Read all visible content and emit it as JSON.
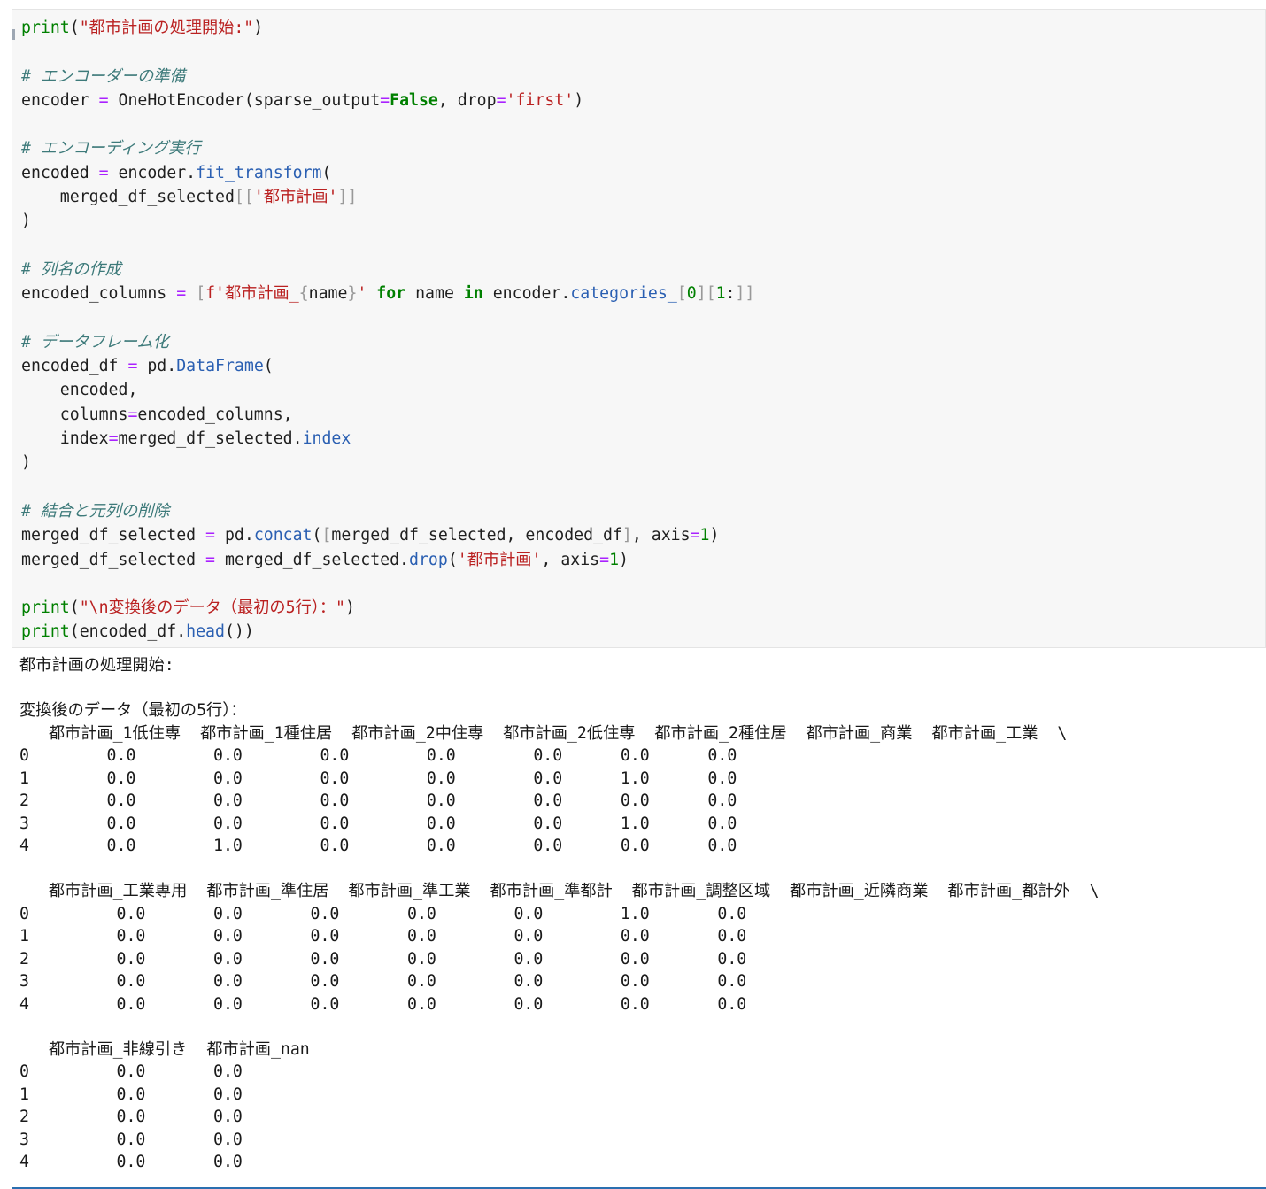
{
  "code_cell": {
    "lines": [
      [
        {
          "t": "print",
          "c": "kw"
        },
        {
          "t": "("
        },
        {
          "t": "\"都市計画の処理開始:\"",
          "c": "st"
        },
        {
          "t": ")"
        }
      ],
      [],
      [
        {
          "t": "# エンコーダーの準備",
          "c": "cm"
        }
      ],
      [
        {
          "t": "encoder "
        },
        {
          "t": "=",
          "c": "op"
        },
        {
          "t": " OneHotEncoder(sparse_output"
        },
        {
          "t": "=",
          "c": "op"
        },
        {
          "t": "False",
          "c": "kwb"
        },
        {
          "t": ", drop"
        },
        {
          "t": "=",
          "c": "op"
        },
        {
          "t": "'first'",
          "c": "st"
        },
        {
          "t": ")"
        }
      ],
      [],
      [
        {
          "t": "# エンコーディング実行",
          "c": "cm"
        }
      ],
      [
        {
          "t": "encoded "
        },
        {
          "t": "=",
          "c": "op"
        },
        {
          "t": " encoder."
        },
        {
          "t": "fit_transform",
          "c": "at"
        },
        {
          "t": "("
        }
      ],
      [
        {
          "t": "    merged_df_selected"
        },
        {
          "t": "[[",
          "c": "br"
        },
        {
          "t": "'都市計画'",
          "c": "st"
        },
        {
          "t": "]]",
          "c": "br"
        }
      ],
      [
        {
          "t": ")"
        }
      ],
      [],
      [
        {
          "t": "# 列名の作成",
          "c": "cm"
        }
      ],
      [
        {
          "t": "encoded_columns "
        },
        {
          "t": "=",
          "c": "op"
        },
        {
          "t": " "
        },
        {
          "t": "[",
          "c": "br"
        },
        {
          "t": "f'都市計画_",
          "c": "st"
        },
        {
          "t": "{",
          "c": "br"
        },
        {
          "t": "name"
        },
        {
          "t": "}",
          "c": "br"
        },
        {
          "t": "'",
          "c": "st"
        },
        {
          "t": " "
        },
        {
          "t": "for",
          "c": "kwb"
        },
        {
          "t": " name "
        },
        {
          "t": "in",
          "c": "kwb"
        },
        {
          "t": " encoder."
        },
        {
          "t": "categories_",
          "c": "at"
        },
        {
          "t": "[",
          "c": "br"
        },
        {
          "t": "0",
          "c": "nm"
        },
        {
          "t": "][",
          "c": "br"
        },
        {
          "t": "1",
          "c": "nm"
        },
        {
          "t": ":"
        },
        {
          "t": "]]",
          "c": "br"
        }
      ],
      [],
      [
        {
          "t": "# データフレーム化",
          "c": "cm"
        }
      ],
      [
        {
          "t": "encoded_df "
        },
        {
          "t": "=",
          "c": "op"
        },
        {
          "t": " pd."
        },
        {
          "t": "DataFrame",
          "c": "at"
        },
        {
          "t": "("
        }
      ],
      [
        {
          "t": "    encoded,"
        }
      ],
      [
        {
          "t": "    columns"
        },
        {
          "t": "=",
          "c": "op"
        },
        {
          "t": "encoded_columns,"
        }
      ],
      [
        {
          "t": "    index"
        },
        {
          "t": "=",
          "c": "op"
        },
        {
          "t": "merged_df_selected."
        },
        {
          "t": "index",
          "c": "at"
        }
      ],
      [
        {
          "t": ")"
        }
      ],
      [],
      [
        {
          "t": "# 結合と元列の削除",
          "c": "cm"
        }
      ],
      [
        {
          "t": "merged_df_selected "
        },
        {
          "t": "=",
          "c": "op"
        },
        {
          "t": " pd."
        },
        {
          "t": "concat",
          "c": "at"
        },
        {
          "t": "("
        },
        {
          "t": "[",
          "c": "br"
        },
        {
          "t": "merged_df_selected, encoded_df"
        },
        {
          "t": "]",
          "c": "br"
        },
        {
          "t": ", axis"
        },
        {
          "t": "=",
          "c": "op"
        },
        {
          "t": "1",
          "c": "nm"
        },
        {
          "t": ")"
        }
      ],
      [
        {
          "t": "merged_df_selected "
        },
        {
          "t": "=",
          "c": "op"
        },
        {
          "t": " merged_df_selected."
        },
        {
          "t": "drop",
          "c": "at"
        },
        {
          "t": "("
        },
        {
          "t": "'都市計画'",
          "c": "st"
        },
        {
          "t": ", axis"
        },
        {
          "t": "=",
          "c": "op"
        },
        {
          "t": "1",
          "c": "nm"
        },
        {
          "t": ")"
        }
      ],
      [],
      [
        {
          "t": "print",
          "c": "kw"
        },
        {
          "t": "("
        },
        {
          "t": "\"\\n変換後のデータ（最初の5行）：\"",
          "c": "st"
        },
        {
          "t": ")"
        }
      ],
      [
        {
          "t": "print",
          "c": "kw"
        },
        {
          "t": "(encoded_df."
        },
        {
          "t": "head",
          "c": "at"
        },
        {
          "t": "())"
        }
      ]
    ]
  },
  "output": {
    "lines": [
      "都市計画の処理開始:",
      "",
      "変換後のデータ（最初の5行）：",
      "   都市計画_1低住専  都市計画_1種住居  都市計画_2中住専  都市計画_2低住専  都市計画_2種住居  都市計画_商業  都市計画_工業  \\",
      "0        0.0        0.0        0.0        0.0        0.0      0.0      0.0",
      "1        0.0        0.0        0.0        0.0        0.0      1.0      0.0",
      "2        0.0        0.0        0.0        0.0        0.0      0.0      0.0",
      "3        0.0        0.0        0.0        0.0        0.0      1.0      0.0",
      "4        0.0        1.0        0.0        0.0        0.0      0.0      0.0",
      "",
      "   都市計画_工業専用  都市計画_準住居  都市計画_準工業  都市計画_準都計  都市計画_調整区域  都市計画_近隣商業  都市計画_都計外  \\",
      "0         0.0       0.0       0.0       0.0        0.0        1.0       0.0",
      "1         0.0       0.0       0.0       0.0        0.0        0.0       0.0",
      "2         0.0       0.0       0.0       0.0        0.0        0.0       0.0",
      "3         0.0       0.0       0.0       0.0        0.0        0.0       0.0",
      "4         0.0       0.0       0.0       0.0        0.0        0.0       0.0",
      "",
      "   都市計画_非線引き  都市計画_nan",
      "0         0.0       0.0",
      "1         0.0       0.0",
      "2         0.0       0.0",
      "3         0.0       0.0",
      "4         0.0       0.0"
    ]
  }
}
